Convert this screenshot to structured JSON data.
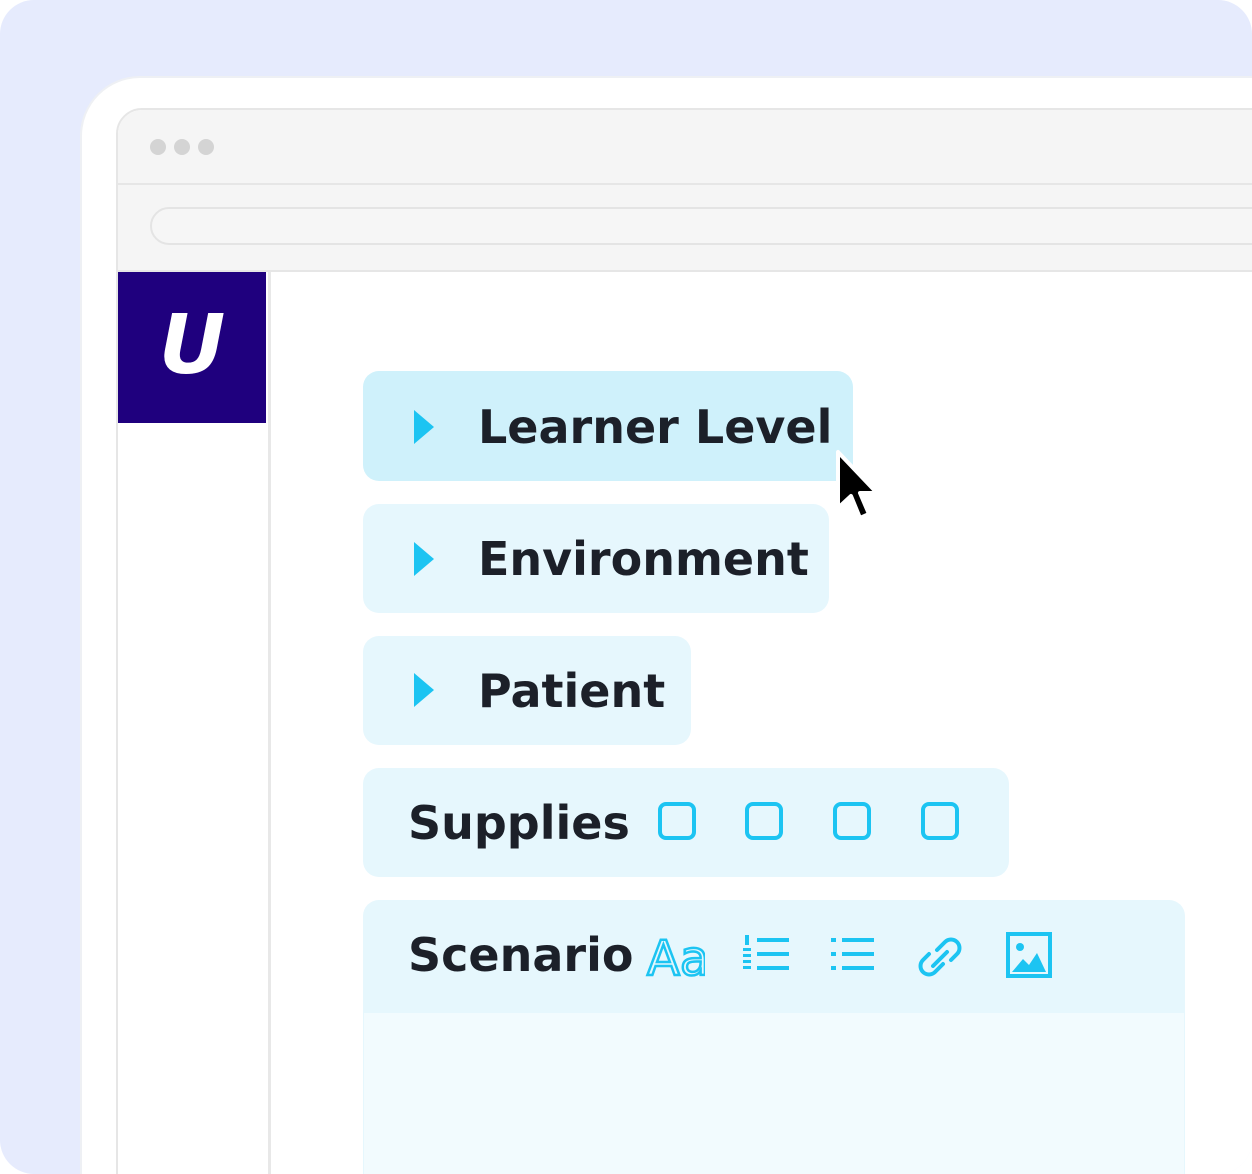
{
  "app": {
    "logo_letter": "U",
    "brand_color": "#1f007e",
    "accent_color": "#1cc4f2"
  },
  "sections": [
    {
      "label": "Learner Level",
      "type": "collapsible",
      "state": "hovered"
    },
    {
      "label": "Environment",
      "type": "collapsible"
    },
    {
      "label": "Patient",
      "type": "collapsible"
    }
  ],
  "supplies": {
    "label": "Supplies",
    "checkboxes": [
      {
        "checked": false
      },
      {
        "checked": false
      },
      {
        "checked": false
      },
      {
        "checked": false
      }
    ]
  },
  "scenario": {
    "label": "Scenario",
    "toolbar": [
      "text-format-icon",
      "numbered-list-icon",
      "bulleted-list-icon",
      "link-icon",
      "image-icon"
    ],
    "text_format_glyph": "Aa",
    "editor_value": ""
  }
}
